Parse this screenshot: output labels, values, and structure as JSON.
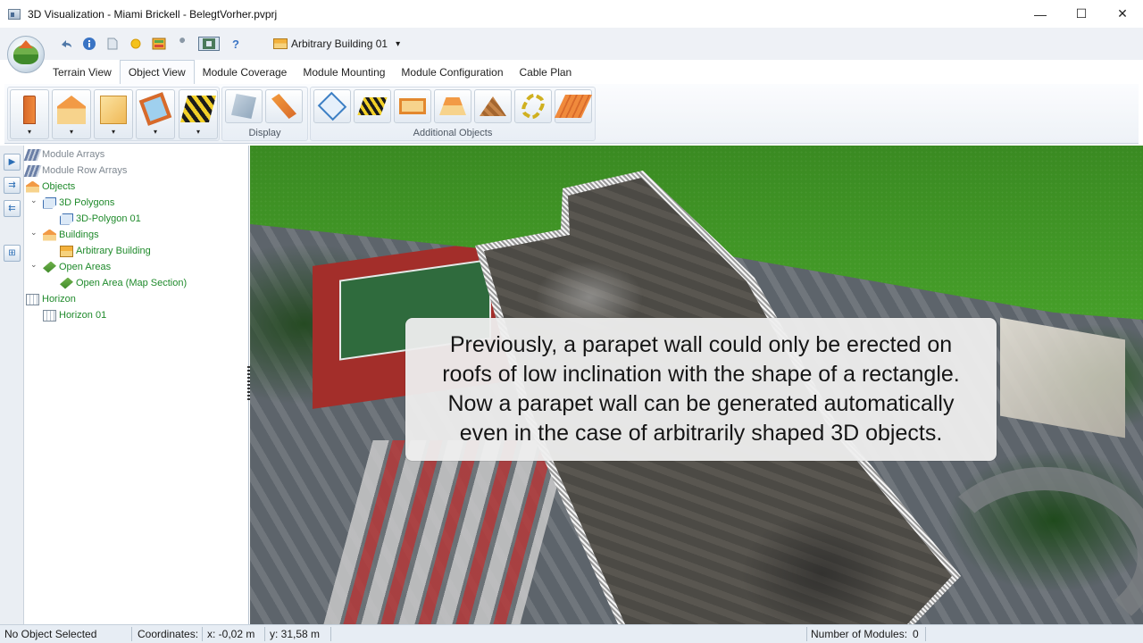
{
  "window": {
    "title": "3D Visualization - Miami Brickell - BelegtVorher.pvprj",
    "controls": {
      "minimize": "—",
      "maximize": "☐",
      "close": "✕"
    }
  },
  "quick_access": {
    "icons": [
      "undo-icon",
      "info-icon",
      "document-icon",
      "sun-icon",
      "layout-icon",
      "wrench-icon",
      "screenshot-icon",
      "help-icon"
    ],
    "help_glyph": "?",
    "selected_object": "Arbitrary Building 01",
    "dropdown_arrow": "▾"
  },
  "tabs": [
    {
      "label": "Terrain View",
      "active": false
    },
    {
      "label": "Object View",
      "active": true
    },
    {
      "label": "Module Coverage",
      "active": false
    },
    {
      "label": "Module Mounting",
      "active": false
    },
    {
      "label": "Module Configuration",
      "active": false
    },
    {
      "label": "Cable Plan",
      "active": false
    }
  ],
  "ribbon": {
    "dropdown_glyph": "▾",
    "object_buttons": [
      "chimney-icon",
      "gable-roof-icon",
      "box-building-icon",
      "skylight-icon",
      "hatched-area-icon"
    ],
    "display_group": {
      "label": "Display",
      "buttons": [
        "display-transparent-icon",
        "display-edges-icon"
      ]
    },
    "additional_group": {
      "label": "Additional Objects",
      "buttons": [
        "pin-object-icon",
        "stripe-object-icon",
        "tray-object-icon",
        "roof-object-icon",
        "pyramid-object-icon",
        "ring-object-icon",
        "plank-object-icon"
      ]
    }
  },
  "left_strip": {
    "buttons": [
      "▶",
      "⇉",
      "⇇",
      "⊞"
    ]
  },
  "tree": [
    {
      "label": "Module Arrays",
      "color": "grey"
    },
    {
      "label": "Module Row Arrays",
      "color": "grey"
    },
    {
      "label": "Objects",
      "color": "green"
    },
    {
      "label": "3D Polygons",
      "color": "green",
      "caret": "⌄"
    },
    {
      "label": "3D-Polygon 01",
      "color": "green"
    },
    {
      "label": "Buildings",
      "color": "green",
      "caret": "⌄"
    },
    {
      "label": "Arbitrary Building",
      "color": "green"
    },
    {
      "label": "Open Areas",
      "color": "green",
      "caret": "⌄"
    },
    {
      "label": "Open Area (Map Section)",
      "color": "green"
    },
    {
      "label": "Horizon",
      "color": "green"
    },
    {
      "label": "Horizon 01",
      "color": "green"
    }
  ],
  "caption": {
    "lines": [
      "Previously, a parapet wall could only be erected on",
      "roofs of low inclination with the shape of a rectangle.",
      "Now a parapet wall can be generated automatically",
      "even in the case of arbitrarily shaped 3D objects."
    ]
  },
  "status": {
    "selection": "No Object Selected",
    "coordinates_label": "Coordinates:",
    "x": "x: -0,02 m",
    "y": "y: 31,58 m",
    "modules_label": "Number of Modules:",
    "modules_value": "0"
  },
  "colors": {
    "tree_green": "#1f8a2b",
    "tree_grey": "#7e8790",
    "ribbon_bg": "#eef2f7",
    "grass": "#3f8f24",
    "caption_bg": "#eeeeee"
  }
}
